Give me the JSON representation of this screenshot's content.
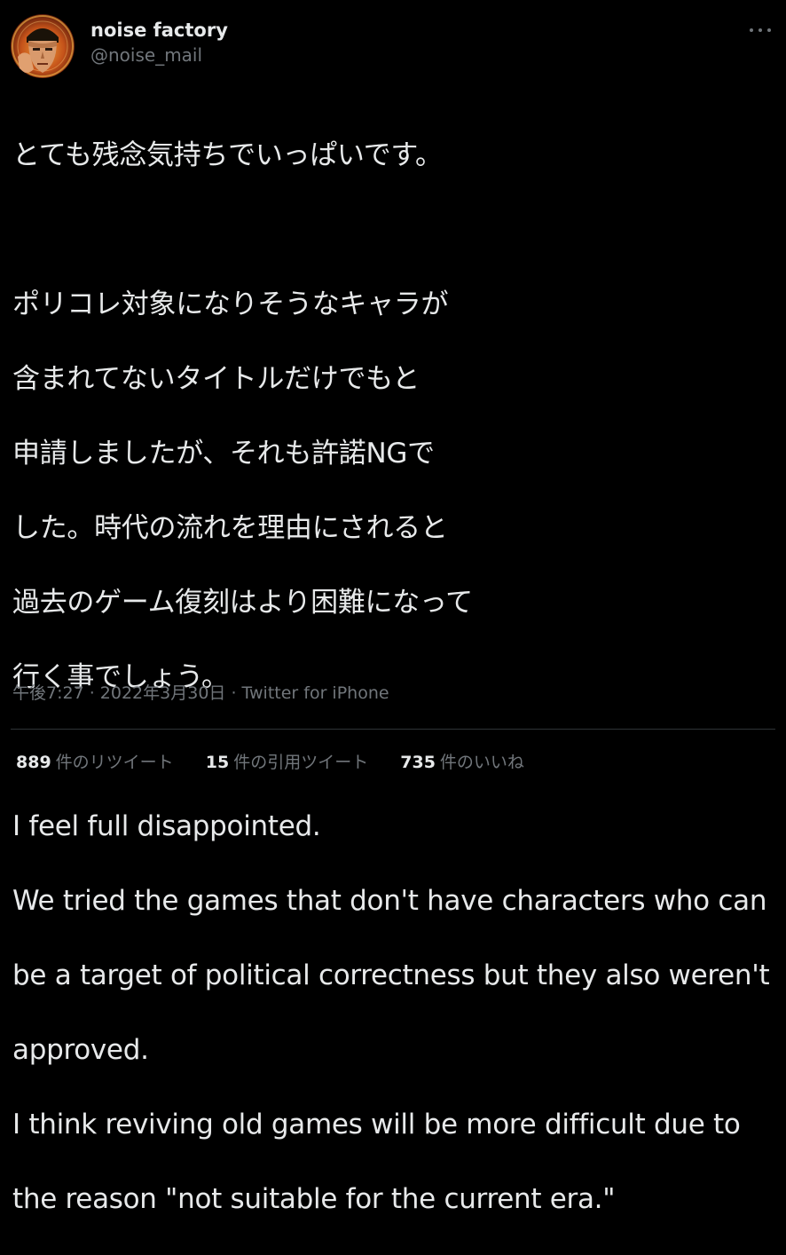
{
  "user": {
    "display_name": "noise factory",
    "handle": "@noise_mail",
    "avatar_icon": "avatar-image"
  },
  "more_icon": "more-horizontal-icon",
  "tweet": {
    "japanese": [
      "とても残念気持ちでいっぱいです。",
      "ポリコレ対象になりそうなキャラが",
      "含まれてないタイトルだけでもと",
      "申請しましたが、それも許諾NGで",
      "した。時代の流れを理由にされると",
      "過去のゲーム復刻はより困難になって",
      "行く事でしょう。"
    ],
    "english": [
      "I feel full disappointed.",
      "We tried the games that don't have characters who can",
      "be a target of political correctness but they also weren't",
      "approved.",
      "I think reviving old games will be more difficult due to",
      "the reason \"not suitable for the current era.\""
    ]
  },
  "meta": {
    "time": "午後7:27",
    "separator": " · ",
    "date": "2022年3月30日",
    "source": "Twitter for iPhone"
  },
  "stats": {
    "retweets_count": "889",
    "retweets_label": "件のリツイート",
    "quotes_count": "15",
    "quotes_label": "件の引用ツイート",
    "likes_count": "735",
    "likes_label": "件のいいね"
  },
  "colors": {
    "background": "#000000",
    "text": "#e7e9ea",
    "secondary": "#71767b",
    "divider": "#2f3336"
  }
}
